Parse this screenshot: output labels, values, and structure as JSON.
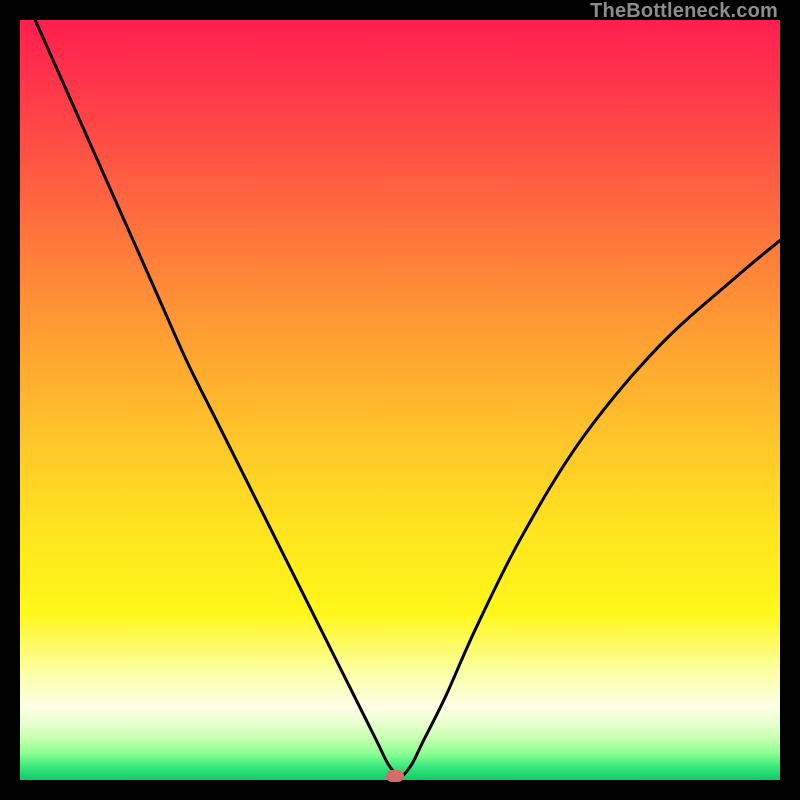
{
  "watermark": "TheBottleneck.com",
  "chart_data": {
    "type": "line",
    "title": "",
    "xlabel": "",
    "ylabel": "",
    "xlim": [
      0,
      100
    ],
    "ylim": [
      0,
      100
    ],
    "gradient_stops": [
      {
        "offset": 0.0,
        "color": "#ff1f4f"
      },
      {
        "offset": 0.1,
        "color": "#ff3a4a"
      },
      {
        "offset": 0.25,
        "color": "#ff6a3f"
      },
      {
        "offset": 0.4,
        "color": "#ff9a34"
      },
      {
        "offset": 0.55,
        "color": "#ffc52a"
      },
      {
        "offset": 0.68,
        "color": "#ffe61f"
      },
      {
        "offset": 0.78,
        "color": "#fff71a"
      },
      {
        "offset": 0.86,
        "color": "#fcffa8"
      },
      {
        "offset": 0.905,
        "color": "#fdffe6"
      },
      {
        "offset": 0.925,
        "color": "#e9ffd0"
      },
      {
        "offset": 0.945,
        "color": "#c7ffb0"
      },
      {
        "offset": 0.965,
        "color": "#8cff93"
      },
      {
        "offset": 0.985,
        "color": "#30e57a"
      },
      {
        "offset": 1.0,
        "color": "#15c96a"
      }
    ],
    "series": [
      {
        "name": "bottleneck-curve",
        "x": [
          2,
          6,
          10,
          14,
          18,
          22,
          26,
          30,
          34,
          38,
          42,
          45,
          47,
          48.5,
          50,
          51.5,
          53,
          56,
          60,
          66,
          74,
          84,
          94,
          100
        ],
        "y": [
          100,
          91,
          82,
          73,
          64,
          55,
          47,
          39,
          31,
          23,
          15,
          9,
          5,
          2,
          0.5,
          2,
          5,
          11,
          20,
          32,
          45,
          57,
          66,
          71
        ]
      }
    ],
    "marker": {
      "x": 49.3,
      "y": 0.5,
      "color": "#d86a6a"
    },
    "curve_color": "#000000",
    "curve_width": 3
  }
}
